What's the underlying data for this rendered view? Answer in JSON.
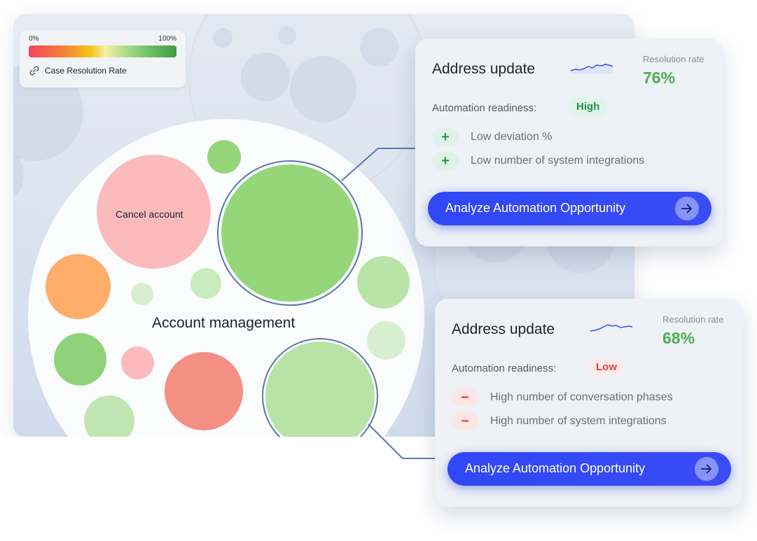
{
  "legend": {
    "min_label": "0%",
    "max_label": "100%",
    "title": "Case Resolution Rate",
    "gradient_colors": [
      "#f0455b",
      "#f57b3b",
      "#f5c518",
      "#f2f0a4",
      "#8fd27b",
      "#3c9b3f"
    ]
  },
  "chart": {
    "group_label": "Account management",
    "bubbles": [
      {
        "label": "Cancel account",
        "color": "#fbbbbd"
      },
      {
        "label": "",
        "color": "#96d67a"
      },
      {
        "label": "",
        "color": "#96d67a"
      },
      {
        "label": "",
        "color": "#b8e4a7"
      },
      {
        "label": "",
        "color": "#ffad6b"
      },
      {
        "label": "",
        "color": "#8fd27b"
      },
      {
        "label": "",
        "color": "#f49083"
      },
      {
        "label": "",
        "color": "#fbbbbd"
      }
    ]
  },
  "cards": [
    {
      "title": "Address update",
      "resolution_label": "Resolution rate",
      "resolution_value": "76%",
      "readiness_label": "Automation readiness:",
      "readiness_value": "High",
      "factors": [
        {
          "sign": "+",
          "text": "Low deviation %"
        },
        {
          "sign": "+",
          "text": "Low number of system integrations"
        }
      ],
      "cta_label": "Analyze Automation Opportunity"
    },
    {
      "title": "Address update",
      "resolution_label": "Resolution rate",
      "resolution_value": "68%",
      "readiness_label": "Automation readiness:",
      "readiness_value": "Low",
      "factors": [
        {
          "sign": "−",
          "text": "High number of conversation phases"
        },
        {
          "sign": "−",
          "text": "High number of system integrations"
        }
      ],
      "cta_label": "Analyze Automation Opportunity"
    }
  ],
  "colors": {
    "accent": "#2f47f5",
    "positive": "#4caf50",
    "negative": "#e0433a",
    "selection_ring": "#5a79a8"
  },
  "icons": [
    "link-icon",
    "sparkline-icon",
    "plus-icon",
    "minus-icon",
    "arrow-right-icon"
  ]
}
